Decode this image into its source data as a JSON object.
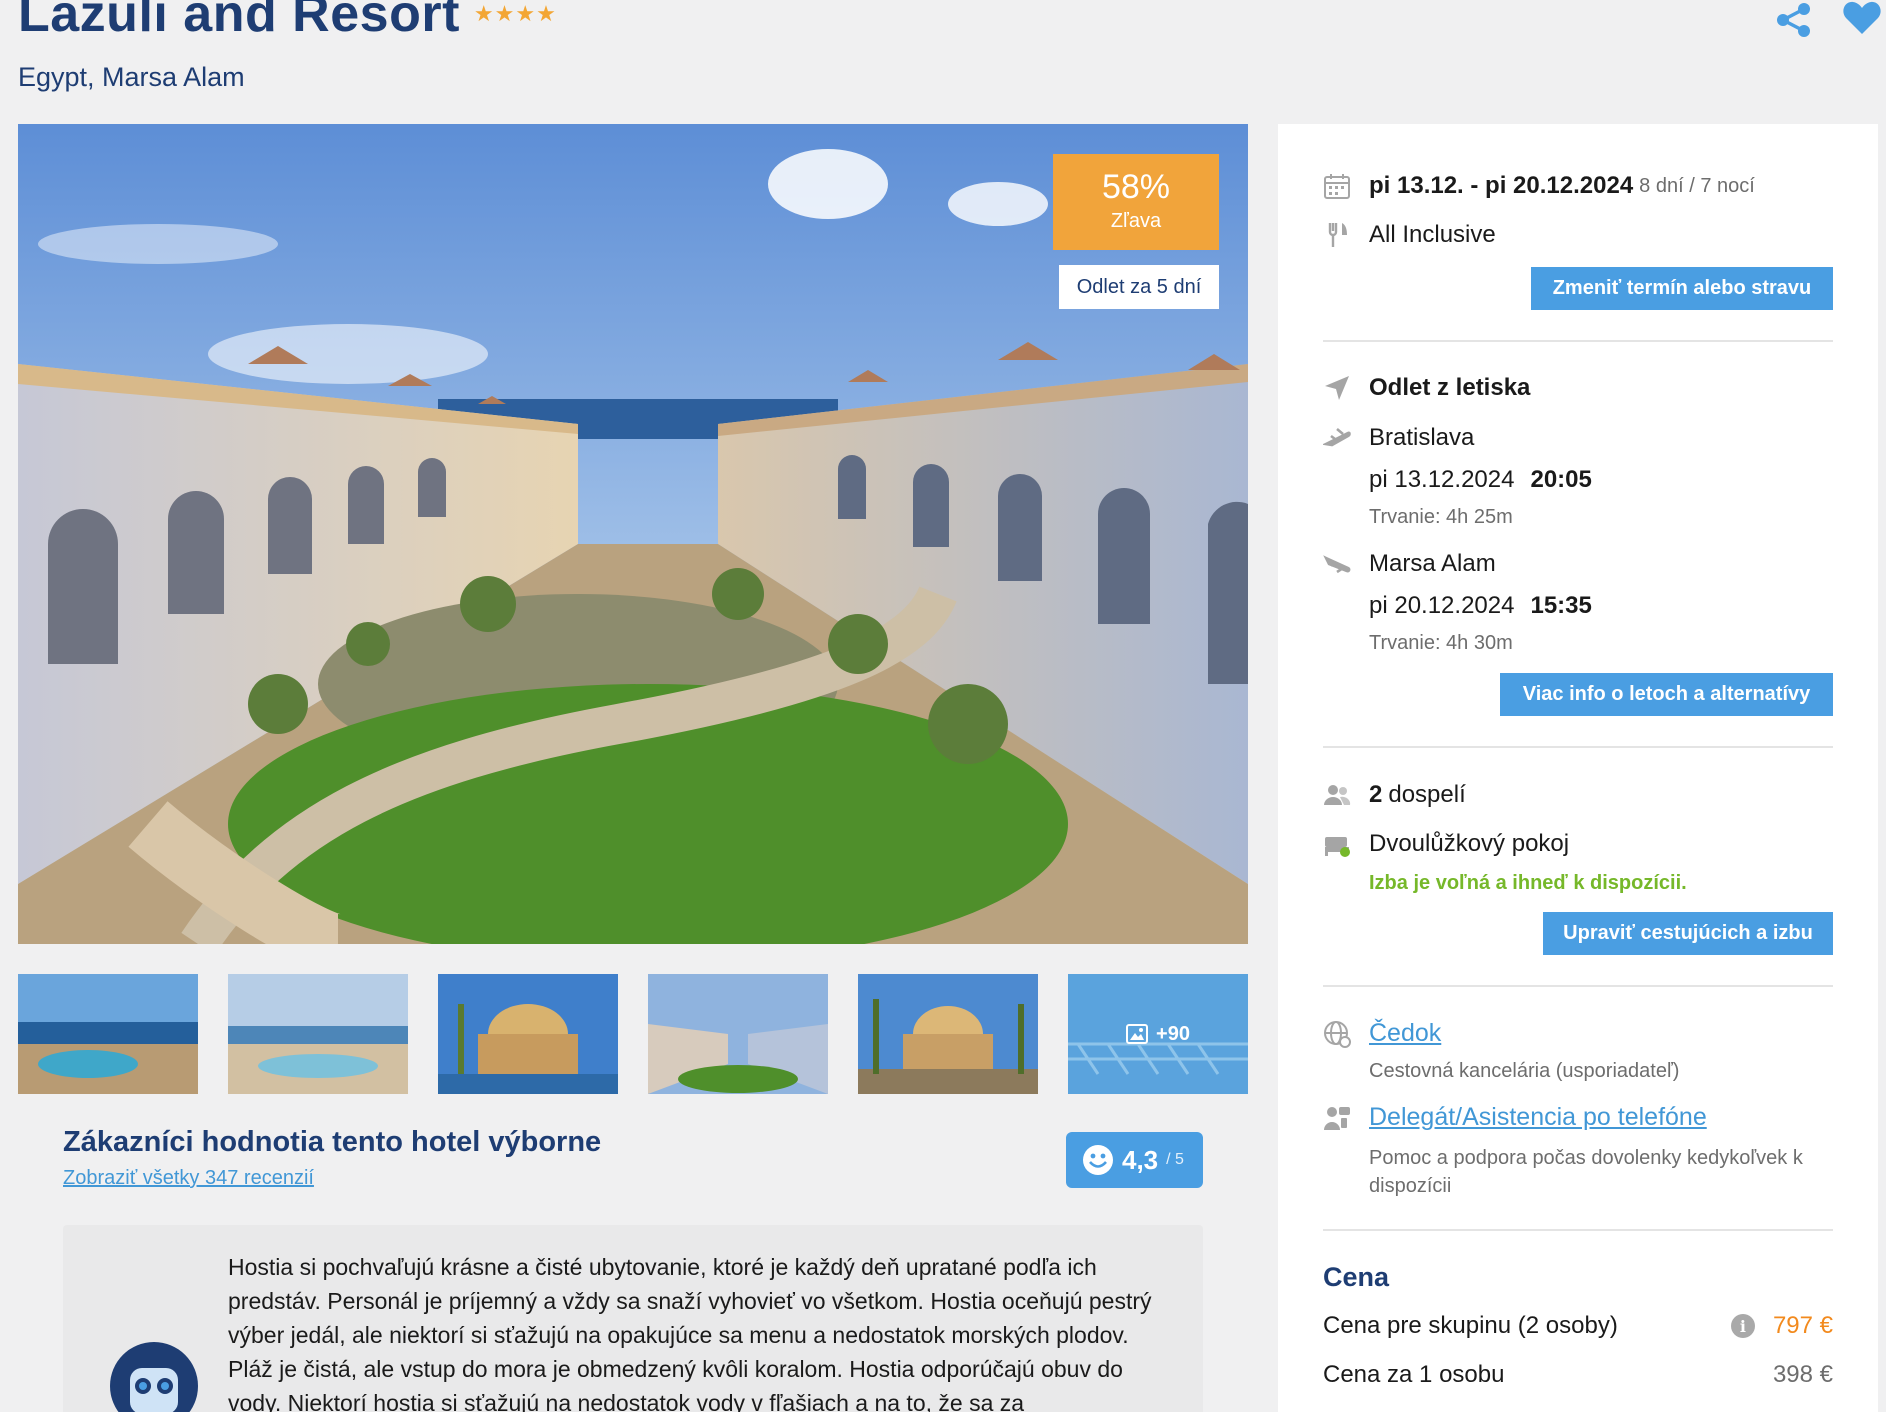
{
  "header": {
    "title": "Lazuli and Resort",
    "stars": "★★★★",
    "location": "Egypt, Marsa Alam"
  },
  "photo": {
    "discount_pct": "58%",
    "discount_label": "Zľava",
    "departure_badge": "Odlet za 5 dní",
    "more_photos": "+90"
  },
  "rating": {
    "heading": "Zákazníci hodnotia tento hotel výborne",
    "link": "Zobraziť všetky 347 recenzií",
    "score": "4,3",
    "max": "/ 5",
    "summary": "Hostia si pochvaľujú krásne a čisté ubytovanie, ktoré je každý deň upratané podľa ich predstáv. Personál je príjemný a vždy sa snaží vyhovieť vo všetkom. Hostia oceňujú pestrý výber jedál, ale niektorí si sťažujú na opakujúce sa menu a nedostatok morských plodov. Pláž je čistá, ale vstup do mora je obmedzený kvôli koralom. Hostia odporúčajú obuv do vody. Niektorí hostia si sťažujú na nedostatok vody v fľašiach a na to, že sa za"
  },
  "booking": {
    "dates": "pi 13.12. - pi 20.12.2024",
    "duration": "8 dní / 7 nocí",
    "board": "All Inclusive",
    "change_button": "Zmeniť termín alebo stravu",
    "flight_heading": "Odlet z letiska",
    "outbound_city": "Bratislava",
    "outbound_date": "pi 13.12.2024",
    "outbound_time": "20:05",
    "outbound_duration": "Trvanie: 4h 25m",
    "return_city": "Marsa Alam",
    "return_date": "pi 20.12.2024",
    "return_time": "15:35",
    "return_duration": "Trvanie: 4h 30m",
    "flights_button": "Viac info o letoch a alternatívy",
    "adults_count": "2",
    "adults_label": "dospelí",
    "room": "Dvoulůžkový pokoj",
    "room_status": "Izba je voľná a ihneď k dispozícii.",
    "travellers_button": "Upraviť cestujúcich a izbu",
    "agency_name": "Čedok",
    "agency_desc": "Cestovná kancelária (usporiadateľ)",
    "assist_link": "Delegát/Asistencia po telefóne",
    "assist_desc": "Pomoc a podpora počas dovolenky kedykoľvek k dispozícii"
  },
  "price": {
    "title": "Cena",
    "group_label": "Cena pre skupinu (2 osoby)",
    "group_value": "797 €",
    "per_person_label": "Cena za 1 osobu",
    "per_person_value": "398 €"
  },
  "colors": {
    "brand_blue": "#1e3d73",
    "button_blue": "#4a9ee2",
    "discount_orange": "#f1a43b",
    "price_orange": "#f28a1e",
    "available_green": "#76b82a"
  }
}
